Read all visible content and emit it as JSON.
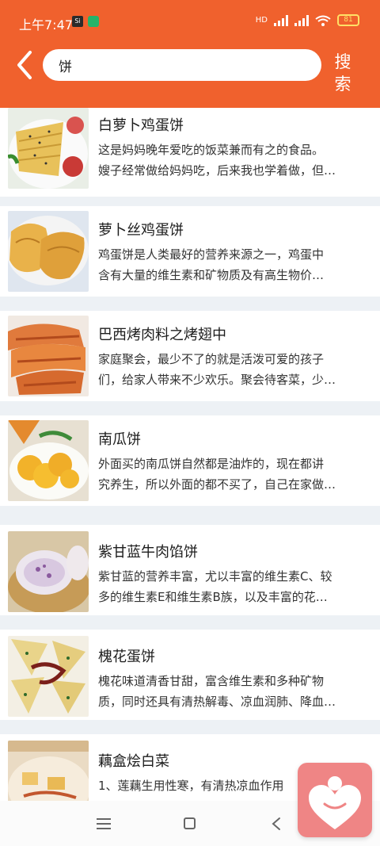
{
  "status_bar": {
    "time": "上午7:47",
    "notif_icons": [
      "app-notification-icon",
      "app-notification-icon"
    ],
    "battery": "81"
  },
  "header": {
    "search": {
      "value": "饼",
      "placeholder": ""
    },
    "search_button": "搜索",
    "back_icon": "chevron-left-icon"
  },
  "colors": {
    "accent": "#f0612d",
    "list_background": "#edf1f5",
    "fab": "#ef8585"
  },
  "recipes": [
    {
      "title": "白萝卜鸡蛋饼",
      "desc_line1": "这是妈妈晚年爱吃的饭菜兼而有之的食品。",
      "desc_line2": "嫂子经常做给妈妈吃，后来我也学着做，但…"
    },
    {
      "title": "萝卜丝鸡蛋饼",
      "desc_line1": "鸡蛋饼是人类最好的营养来源之一，鸡蛋中",
      "desc_line2": "含有大量的维生素和矿物质及有高生物价…"
    },
    {
      "title": "巴西烤肉料之烤翅中",
      "desc_line1": "家庭聚会，最少不了的就是活泼可爱的孩子",
      "desc_line2": "们，给家人带来不少欢乐。聚会待客菜，少…"
    },
    {
      "title": "南瓜饼",
      "desc_line1": "外面买的南瓜饼自然都是油炸的，现在都讲",
      "desc_line2": "究养生，所以外面的都不买了，自己在家做…"
    },
    {
      "title": "紫甘蓝牛肉馅饼",
      "desc_line1": "紫甘蓝的营养丰富，尤以丰富的维生素C、较",
      "desc_line2": "多的维生素E和维生素B族，以及丰富的花…"
    },
    {
      "title": "槐花蛋饼",
      "desc_line1": "槐花味道清香甘甜，富含维生素和多种矿物",
      "desc_line2": "质，同时还具有清热解毒、凉血润肺、降血…"
    },
    {
      "title": "藕盒烩白菜",
      "desc_line1": "1、莲藕生用性寒，有清热凉血作用",
      "desc_line2": ""
    }
  ],
  "nav_bar": [
    "menu-icon",
    "home-icon",
    "back-icon"
  ],
  "fab_icon": "heart-person-icon"
}
